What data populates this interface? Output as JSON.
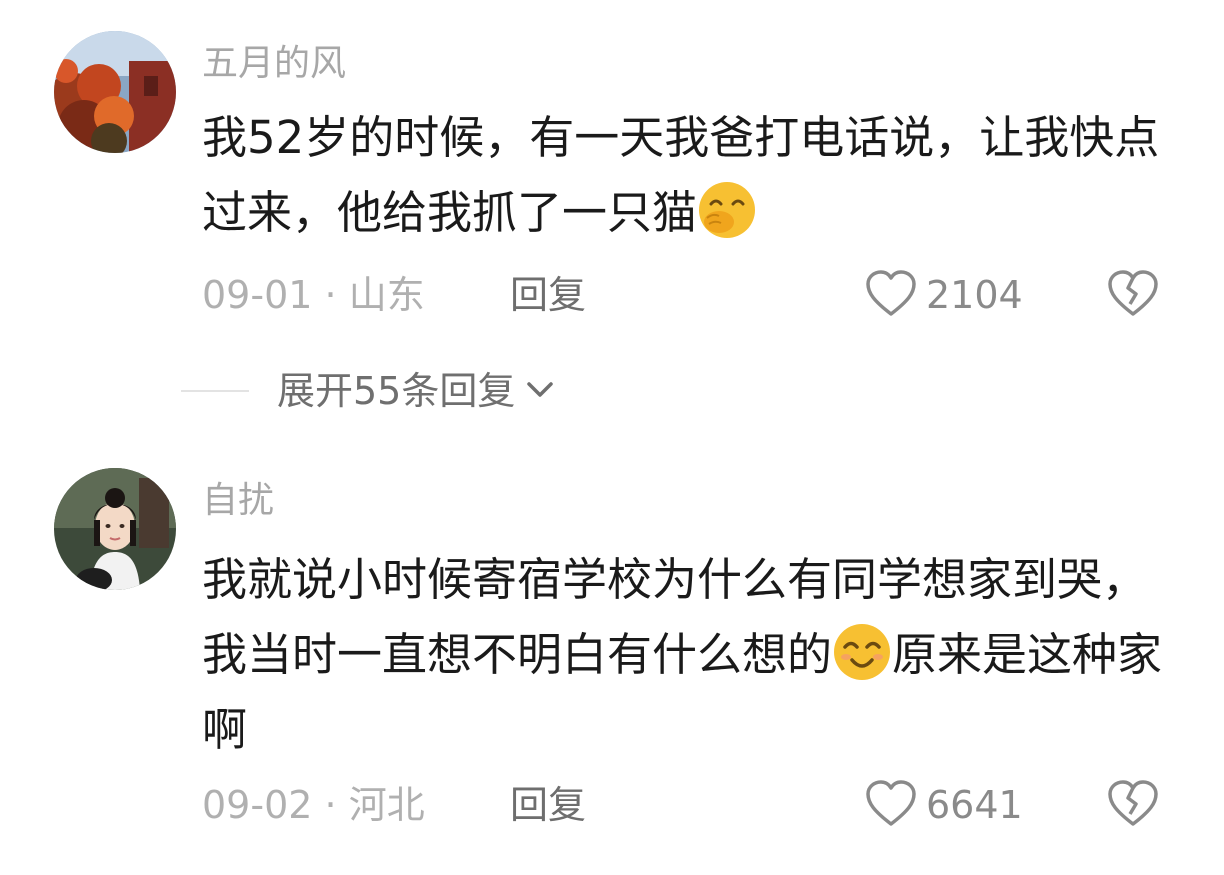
{
  "comments": [
    {
      "author": "五月的风",
      "text_before_emoji": "我52岁的时候，有一天我爸打电话说，让我快点过来，他给我抓了一只猫",
      "text_after_emoji": "",
      "emoji": "covering-mouth-emoji",
      "date": "09-01",
      "separator": "·",
      "location": "山东",
      "reply_label": "回复",
      "likes": "2104"
    },
    {
      "author": "自扰",
      "text_before_emoji": "我就说小时候寄宿学校为什么有同学想家到哭，我当时一直想不明白有什么想的",
      "text_after_emoji": "原来是这种家啊",
      "emoji": "smiling-emoji",
      "date": "09-02",
      "separator": "·",
      "location": "河北",
      "reply_label": "回复",
      "likes": "6641"
    }
  ],
  "expand_replies": {
    "label": "展开55条回复"
  },
  "colors": {
    "author": "#a7a7a7",
    "body": "#1a1a1a",
    "meta": "#b0b0b0",
    "icon": "#8a8a8a",
    "emoji": "#f7c032"
  },
  "icons": {
    "like": "heart-outline-icon",
    "dislike": "broken-heart-icon",
    "expand": "chevron-down-icon"
  }
}
